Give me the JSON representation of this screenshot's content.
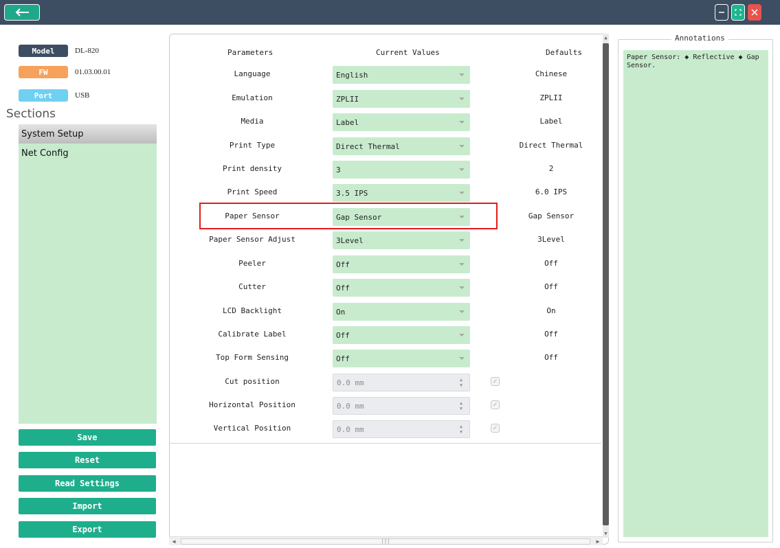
{
  "window": {
    "back_icon": "arrow-left-icon",
    "minimize_icon": "minimize-icon",
    "maximize_icon": "expand-icon",
    "close_icon": "close-icon"
  },
  "device": {
    "model_label": "Model",
    "model_value": "DL-820",
    "fw_label": "FW",
    "fw_value": "01.03.00.01",
    "port_label": "Port",
    "port_value": "USB"
  },
  "sections": {
    "title": "Sections",
    "items": [
      {
        "label": "System Setup",
        "active": true
      },
      {
        "label": "Net Config",
        "active": false
      }
    ]
  },
  "actions": {
    "save": "Save",
    "reset": "Reset",
    "read_settings": "Read Settings",
    "import": "Import",
    "export": "Export"
  },
  "table": {
    "headers": {
      "parameters": "Parameters",
      "current": "Current Values",
      "defaults": "Defaults"
    },
    "rows": [
      {
        "param": "Language",
        "value": "English",
        "default": "Chinese",
        "type": "dropdown"
      },
      {
        "param": "Emulation",
        "value": "ZPLII",
        "default": "ZPLII",
        "type": "dropdown"
      },
      {
        "param": "Media",
        "value": "Label",
        "default": "Label",
        "type": "dropdown"
      },
      {
        "param": "Print Type",
        "value": "Direct Thermal",
        "default": "Direct Thermal",
        "type": "dropdown"
      },
      {
        "param": "Print density",
        "value": "3",
        "default": "2",
        "type": "dropdown"
      },
      {
        "param": "Print Speed",
        "value": "3.5 IPS",
        "default": "6.0 IPS",
        "type": "dropdown"
      },
      {
        "param": "Paper Sensor",
        "value": "Gap Sensor",
        "default": "Gap Sensor",
        "type": "dropdown"
      },
      {
        "param": "Paper Sensor Adjust",
        "value": "3Level",
        "default": "3Level",
        "type": "dropdown"
      },
      {
        "param": "Peeler",
        "value": "Off",
        "default": "Off",
        "type": "dropdown"
      },
      {
        "param": "Cutter",
        "value": "Off",
        "default": "Off",
        "type": "dropdown"
      },
      {
        "param": "LCD Backlight",
        "value": "On",
        "default": "On",
        "type": "dropdown"
      },
      {
        "param": "Calibrate Label",
        "value": "Off",
        "default": "Off",
        "type": "dropdown"
      },
      {
        "param": "Top Form Sensing",
        "value": "Off",
        "default": "Off",
        "type": "dropdown"
      },
      {
        "param": "Cut position",
        "value": "0.0 mm",
        "default": "",
        "type": "spinner"
      },
      {
        "param": "Horizontal Position",
        "value": "0.0 mm",
        "default": "",
        "type": "spinner"
      },
      {
        "param": "Vertical Position",
        "value": "0.0 mm",
        "default": "",
        "type": "spinner"
      }
    ]
  },
  "annotations": {
    "title": "Annotations",
    "text": "Paper Sensor: ◆ Reflective ◆ Gap Sensor."
  },
  "colors": {
    "titlebar": "#3d4e63",
    "accent_green": "#1fae8c",
    "field_green": "#c8ebce",
    "model_badge": "#3d4e63",
    "fw_badge": "#f6a25c",
    "port_badge": "#6fd0f2",
    "highlight_red": "#e31b1b"
  }
}
